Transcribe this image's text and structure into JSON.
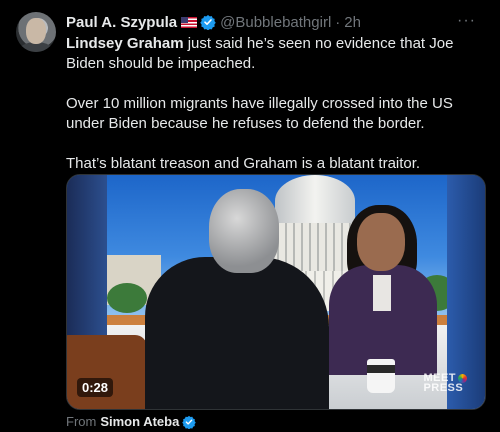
{
  "author": {
    "name": "Paul A. Szypula",
    "handle": "@Bubblebathgirl",
    "separator": "·",
    "time": "2h"
  },
  "more_label": "···",
  "tweet": {
    "mention": "Lindsey Graham",
    "line1_rest": " just said he’s seen no evidence that Joe Biden should be impeached.",
    "paragraph2": "Over 10 million migrants have illegally crossed into the US under Biden because he refuses to defend the border.",
    "paragraph3": "That’s blatant treason and Graham is a blatant traitor."
  },
  "media": {
    "duration": "0:28",
    "watermark_line1": "MEET",
    "watermark_line2": "PRESS"
  },
  "from": {
    "label": "From",
    "source": "Simon Ateba"
  },
  "colors": {
    "verified": "#1d9bf0",
    "muted_text": "#71767b",
    "main_text": "#e7e9ea"
  }
}
